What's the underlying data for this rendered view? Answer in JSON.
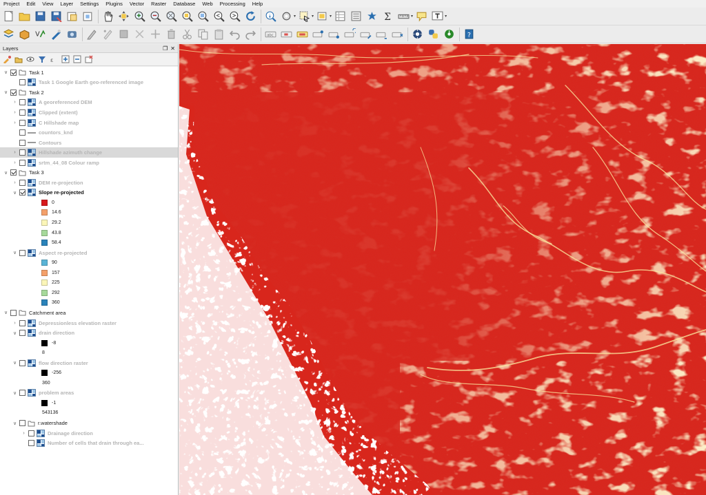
{
  "menu": [
    "Project",
    "Edit",
    "View",
    "Layer",
    "Settings",
    "Plugins",
    "Vector",
    "Raster",
    "Database",
    "Web",
    "Processing",
    "Help"
  ],
  "toolbar1": [
    {
      "icon": "new-project-icon"
    },
    {
      "icon": "open-project-icon"
    },
    {
      "icon": "save-project-icon"
    },
    {
      "icon": "save-as-icon"
    },
    {
      "icon": "print-composer-icon"
    },
    {
      "icon": "composer-manager-icon"
    },
    {
      "sep": true
    },
    {
      "icon": "pan-icon"
    },
    {
      "icon": "pan-to-selection-icon"
    },
    {
      "icon": "zoom-in-icon"
    },
    {
      "icon": "zoom-out-icon"
    },
    {
      "icon": "zoom-full-icon"
    },
    {
      "icon": "zoom-to-selection-icon"
    },
    {
      "icon": "zoom-to-layer-icon"
    },
    {
      "icon": "zoom-last-icon"
    },
    {
      "icon": "zoom-next-icon"
    },
    {
      "icon": "refresh-icon"
    },
    {
      "sep": true
    },
    {
      "icon": "identify-icon"
    },
    {
      "icon": "action-icon",
      "dropdown": true
    },
    {
      "icon": "select-icon",
      "dropdown": true
    },
    {
      "icon": "deselect-icon",
      "dropdown": true
    },
    {
      "icon": "open-attribute-table-icon"
    },
    {
      "icon": "field-calculator-icon"
    },
    {
      "icon": "statistics-icon"
    },
    {
      "icon": "sum-icon"
    },
    {
      "icon": "measure-icon",
      "dropdown": true
    },
    {
      "icon": "map-tips-icon"
    },
    {
      "icon": "text-annotation-icon",
      "dropdown": true
    }
  ],
  "toolbar2": [
    {
      "icon": "data-source-manager-icon"
    },
    {
      "icon": "add-vector-icon"
    },
    {
      "icon": "add-raster-icon"
    },
    {
      "icon": "digitize-icon"
    },
    {
      "icon": "add-wms-icon"
    },
    {
      "sep": true
    },
    {
      "icon": "edit-pencil-icon"
    },
    {
      "icon": "node-tool-icon"
    },
    {
      "icon": "save-edits-icon"
    },
    {
      "icon": "add-feature-icon"
    },
    {
      "icon": "move-feature-icon"
    },
    {
      "icon": "delete-icon"
    },
    {
      "icon": "cut-icon"
    },
    {
      "icon": "copy-icon"
    },
    {
      "icon": "paste-icon"
    },
    {
      "icon": "undo-icon"
    },
    {
      "icon": "redo-icon"
    },
    {
      "sep": true
    },
    {
      "icon": "label-icon"
    },
    {
      "icon": "label-move-icon"
    },
    {
      "icon": "label-style-icon"
    },
    {
      "icon": "label-pin-icon"
    },
    {
      "icon": "label-show-icon"
    },
    {
      "icon": "label-rotate-icon"
    },
    {
      "icon": "label-change-icon"
    },
    {
      "icon": "label-toggle-icon"
    },
    {
      "icon": "label-diagram-icon"
    },
    {
      "sep": true
    },
    {
      "icon": "gps-icon"
    },
    {
      "icon": "python-console-icon"
    },
    {
      "icon": "metasearch-icon"
    },
    {
      "sep": true
    },
    {
      "icon": "help-icon"
    }
  ],
  "panel": {
    "title": "Layers"
  },
  "panel_tools": [
    "open-styling-icon",
    "add-group-icon",
    "manage-visibility-icon",
    "filter-legend-icon",
    "filter-expression-icon",
    "expand-all-icon",
    "collapse-all-icon",
    "remove-layer-icon"
  ],
  "tree": [
    {
      "type": "group",
      "arrow": "open",
      "checked": true,
      "label": "Task 1",
      "indent": 0,
      "style": ""
    },
    {
      "type": "raster",
      "arrow": "",
      "checked": false,
      "label": "Task 1 Google Earth geo-referenced image",
      "indent": 1,
      "style": "faded"
    },
    {
      "type": "group",
      "arrow": "open",
      "checked": true,
      "label": "Task 2",
      "indent": 0,
      "style": ""
    },
    {
      "type": "raster",
      "arrow": "closed",
      "checked": false,
      "label": "A georeferenced DEM",
      "indent": 1,
      "style": "faded"
    },
    {
      "type": "raster",
      "arrow": "closed",
      "checked": false,
      "label": "Clipped (extent)",
      "indent": 1,
      "style": "faded"
    },
    {
      "type": "raster",
      "arrow": "closed",
      "checked": false,
      "label": "C Hillshade map",
      "indent": 1,
      "style": "faded"
    },
    {
      "type": "line",
      "arrow": "",
      "checked": false,
      "label": "countors_knd",
      "indent": 1,
      "style": "faded"
    },
    {
      "type": "line",
      "arrow": "",
      "checked": false,
      "label": "Contours",
      "indent": 1,
      "style": "faded"
    },
    {
      "type": "raster",
      "arrow": "closed",
      "checked": false,
      "label": "Hillshade azimuth change",
      "indent": 1,
      "style": "faded",
      "selected": true
    },
    {
      "type": "raster",
      "arrow": "closed",
      "checked": false,
      "label": "srtm_44_08 Colour ramp",
      "indent": 1,
      "style": "faded"
    },
    {
      "type": "group",
      "arrow": "open",
      "checked": true,
      "label": "Task 3",
      "indent": 0,
      "style": ""
    },
    {
      "type": "raster",
      "arrow": "closed",
      "checked": false,
      "label": "DEM re-projection",
      "indent": 1,
      "style": "faded"
    },
    {
      "type": "raster",
      "arrow": "open",
      "checked": true,
      "label": "Slope re-projected",
      "indent": 1,
      "style": "bold"
    },
    {
      "type": "legend",
      "color": "#d7191c",
      "label": "0"
    },
    {
      "type": "legend",
      "color": "#f4a06a",
      "label": "14.6"
    },
    {
      "type": "legend",
      "color": "#fbf6b8",
      "label": "29.2"
    },
    {
      "type": "legend",
      "color": "#a6d99a",
      "label": "43.8"
    },
    {
      "type": "legend",
      "color": "#2b83ba",
      "label": "58.4"
    },
    {
      "type": "raster",
      "arrow": "open",
      "checked": false,
      "label": "Aspect re-projected",
      "indent": 1,
      "style": "faded"
    },
    {
      "type": "legend",
      "color": "#5ab4d6",
      "label": "90"
    },
    {
      "type": "legend",
      "color": "#f4a06a",
      "label": "157"
    },
    {
      "type": "legend",
      "color": "#fbf6b8",
      "label": "225"
    },
    {
      "type": "legend",
      "color": "#a6d99a",
      "label": "292"
    },
    {
      "type": "legend",
      "color": "#2b83ba",
      "label": "360"
    },
    {
      "type": "group",
      "arrow": "open",
      "checked": false,
      "label": "Catchment area",
      "indent": 0,
      "style": ""
    },
    {
      "type": "raster",
      "arrow": "closed",
      "checked": false,
      "label": "Depressionless elevation raster",
      "indent": 1,
      "style": "faded"
    },
    {
      "type": "raster",
      "arrow": "open",
      "checked": false,
      "label": "drain direction",
      "indent": 1,
      "style": "faded"
    },
    {
      "type": "legend",
      "color": "#000000",
      "label": "-8"
    },
    {
      "type": "legend",
      "color": "",
      "label": "8"
    },
    {
      "type": "raster",
      "arrow": "open",
      "checked": false,
      "label": "flow direction raster",
      "indent": 1,
      "style": "faded"
    },
    {
      "type": "legend",
      "color": "#000000",
      "label": "-256"
    },
    {
      "type": "legend",
      "color": "",
      "label": "360"
    },
    {
      "type": "raster",
      "arrow": "open",
      "checked": false,
      "label": "problem areas",
      "indent": 1,
      "style": "faded"
    },
    {
      "type": "legend",
      "color": "#000000",
      "label": "-1"
    },
    {
      "type": "legend",
      "color": "",
      "label": "543136"
    },
    {
      "type": "group",
      "arrow": "open",
      "checked": false,
      "label": "r.watershade",
      "indent": 1,
      "style": ""
    },
    {
      "type": "raster",
      "arrow": "closed",
      "checked": false,
      "label": "Drainage direction",
      "indent": 2,
      "style": "faded"
    },
    {
      "type": "raster",
      "arrow": "",
      "checked": false,
      "label": "Number of cells that drain through ea...",
      "indent": 2,
      "style": "faded"
    }
  ],
  "map": {
    "layer": "Slope re-projected",
    "base_color": "#d8261c",
    "ridge_color": "#fbe9a0",
    "nodata_color": "#ffffff"
  }
}
